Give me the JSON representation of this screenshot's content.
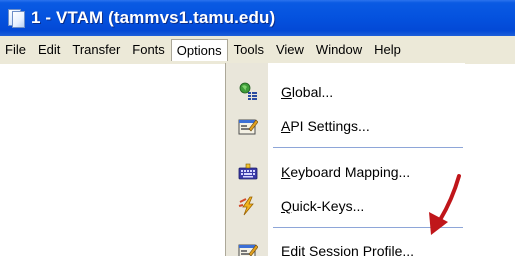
{
  "window": {
    "title": "1 - VTAM (tammvs1.tamu.edu)",
    "icon": "terminal-session-icon"
  },
  "menubar": {
    "items": [
      {
        "label": "File"
      },
      {
        "label": "Edit"
      },
      {
        "label": "Transfer"
      },
      {
        "label": "Fonts"
      },
      {
        "label": "Options",
        "active": true
      },
      {
        "label": "Tools"
      },
      {
        "label": "View"
      },
      {
        "label": "Window"
      },
      {
        "label": "Help"
      }
    ]
  },
  "options_menu": {
    "items": [
      {
        "mnemonic": "G",
        "rest": "lobal...",
        "icon": "global-settings-icon"
      },
      {
        "mnemonic": "A",
        "rest": "PI Settings...",
        "icon": "api-settings-icon"
      },
      {
        "mnemonic": "K",
        "rest": "eyboard Mapping...",
        "icon": "keyboard-icon"
      },
      {
        "mnemonic": "Q",
        "rest": "uick-Keys...",
        "icon": "quick-keys-icon"
      },
      {
        "mnemonic": "E",
        "rest": "dit Session Profile...",
        "icon": "session-profile-icon"
      }
    ]
  },
  "colors": {
    "titlebar": "#0553df",
    "menubar": "#ece9d8",
    "separator": "#8ea6d8",
    "annotation_arrow": "#c0161a"
  }
}
